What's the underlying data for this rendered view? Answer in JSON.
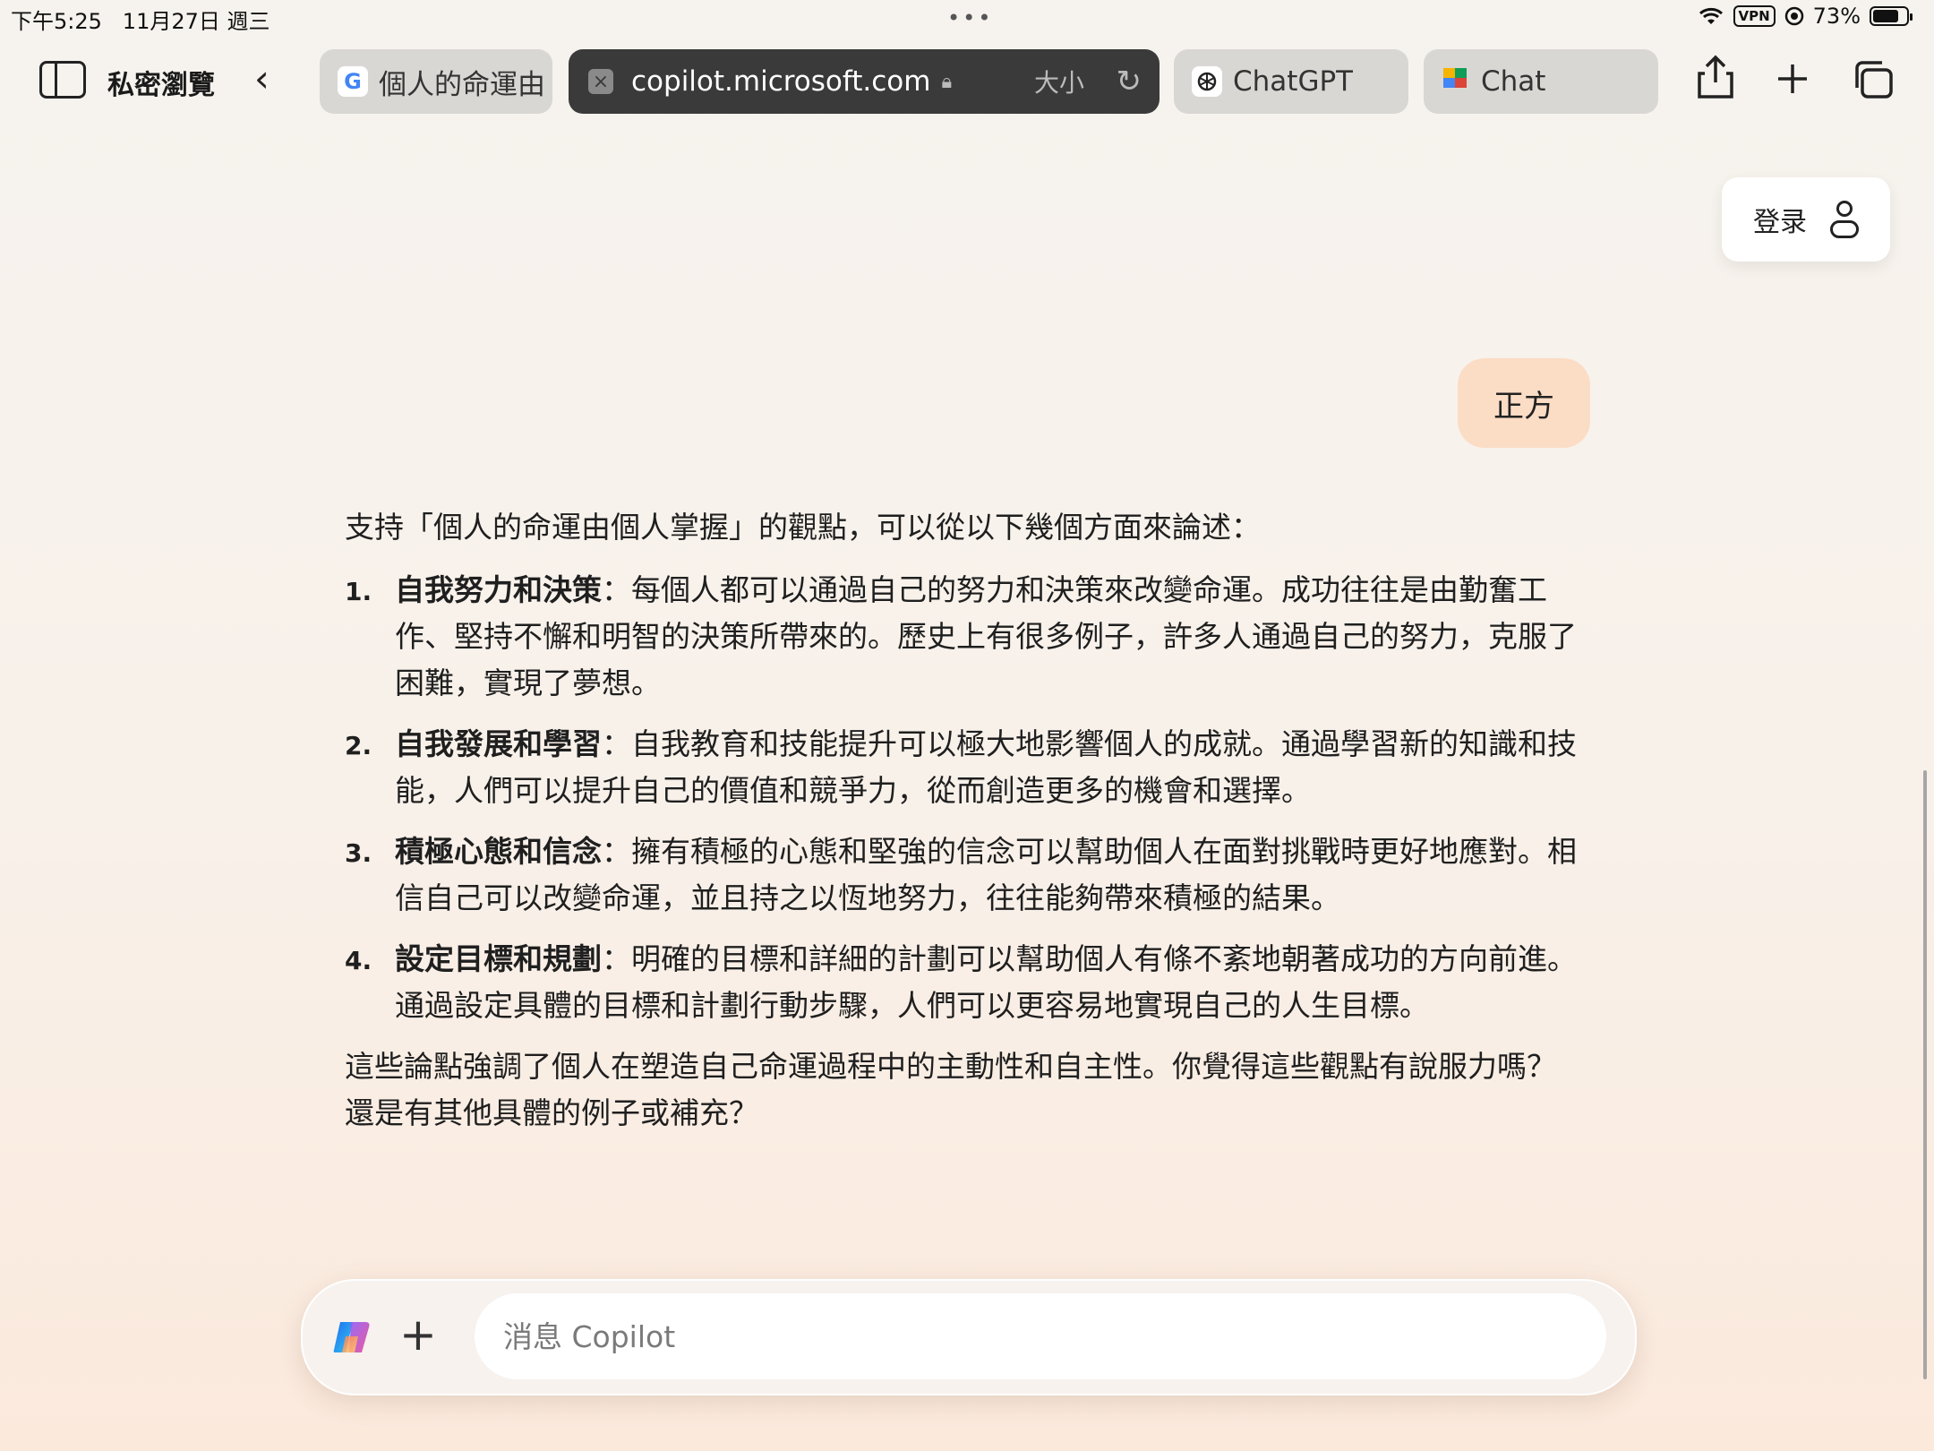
{
  "status_bar": {
    "time": "下午5:25",
    "date": "11月27日 週三",
    "vpn": "VPN",
    "battery": "73%"
  },
  "toolbar": {
    "private_label": "私密瀏覽",
    "tabs": [
      {
        "label": "個人的命運由",
        "favicon": "G",
        "state": "inactive"
      },
      {
        "label": "copilot.microsoft.com",
        "state": "active",
        "size_label": "大小"
      },
      {
        "label": "ChatGPT",
        "state": "inactive"
      },
      {
        "label": "Chat",
        "state": "inactive"
      }
    ]
  },
  "header": {
    "login_label": "登录"
  },
  "conversation": {
    "user_message": "正方",
    "intro": "支持「個人的命運由個人掌握」的觀點，可以從以下幾個方面來論述：",
    "points": [
      {
        "num": "1.",
        "title": "自我努力和決策",
        "text": "：每個人都可以通過自己的努力和決策來改變命運。成功往往是由勤奮工作、堅持不懈和明智的決策所帶來的。歷史上有很多例子，許多人通過自己的努力，克服了困難，實現了夢想。"
      },
      {
        "num": "2.",
        "title": "自我發展和學習",
        "text": "：自我教育和技能提升可以極大地影響個人的成就。通過學習新的知識和技能，人們可以提升自己的價值和競爭力，從而創造更多的機會和選擇。"
      },
      {
        "num": "3.",
        "title": "積極心態和信念",
        "text": "：擁有積極的心態和堅強的信念可以幫助個人在面對挑戰時更好地應對。相信自己可以改變命運，並且持之以恆地努力，往往能夠帶來積極的結果。"
      },
      {
        "num": "4.",
        "title": "設定目標和規劃",
        "text": "：明確的目標和詳細的計劃可以幫助個人有條不紊地朝著成功的方向前進。通過設定具體的目標和計劃行動步驟，人們可以更容易地實現自己的人生目標。"
      }
    ],
    "conclusion": "這些論點強調了個人在塑造自己命運過程中的主動性和自主性。你覺得這些觀點有說服力嗎？還是有其他具體的例子或補充？"
  },
  "composer": {
    "placeholder": "消息 Copilot",
    "value": ""
  },
  "icons": {
    "wifi": "wifi-icon",
    "moon": "focus-icon",
    "share": "share-icon",
    "new_tab": "plus-icon",
    "tabs_overview": "tabs-icon",
    "copilot_logo": "copilot-logo-icon"
  }
}
